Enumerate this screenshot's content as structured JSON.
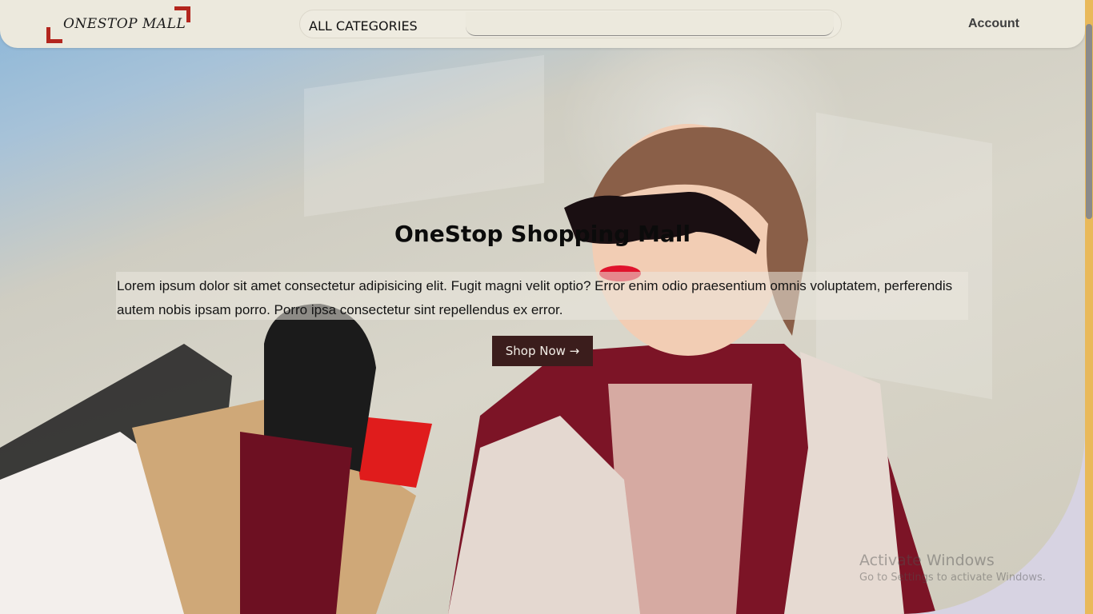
{
  "header": {
    "logo_text": "ONESTOP MALL",
    "category_label": "ALL CATEGORIES",
    "search_placeholder": "",
    "account_label": "Account"
  },
  "hero": {
    "title": "OneStop Shopping Mall",
    "description": "Lorem ipsum dolor sit amet consectetur adipisicing elit. Fugit magni velit optio? Error enim odio praesentium omnis voluptatem, perferendis autem nobis ipsam porro. Porro ipsa consectetur sint repellendus ex error.",
    "cta_label": "Shop Now →"
  },
  "watermark": {
    "line1": "Activate Windows",
    "line2": "Go to Settings to activate Windows."
  },
  "colors": {
    "accent": "#b3261e",
    "cta_bg": "#3b1d1c",
    "header_bg": "#ece9dd",
    "scrollbar_track": "#e9b95a"
  }
}
